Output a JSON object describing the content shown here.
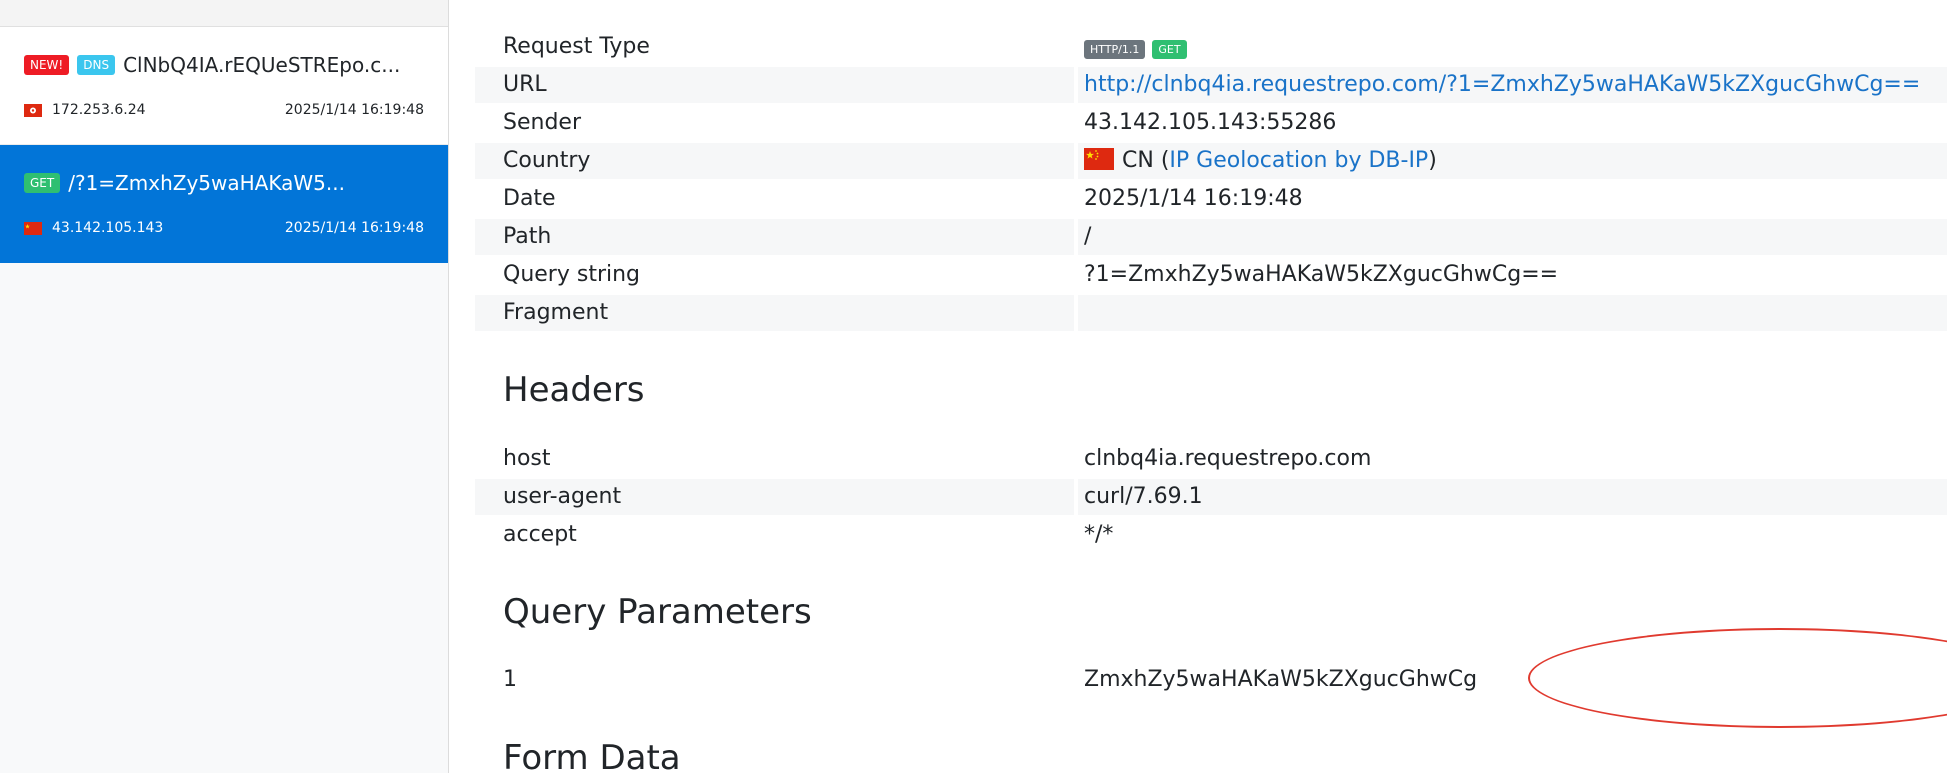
{
  "sidebar": {
    "requests": [
      {
        "badges": [
          "NEW!",
          "DNS"
        ],
        "title": "ClNbQ4IA.rEQUeSTREpo.c...",
        "ip": "172.253.6.24",
        "date": "2025/1/14 16:19:48",
        "selected": false,
        "flag_icon": "hong-kong-flag-icon"
      },
      {
        "badges": [
          "GET"
        ],
        "title": "/?1=ZmxhZy5waHAKaW5...",
        "ip": "43.142.105.143",
        "date": "2025/1/14 16:19:48",
        "selected": true,
        "flag_icon": "china-flag-icon"
      }
    ]
  },
  "details": {
    "request_type_label": "Request Type",
    "protocol_badge": "HTTP/1.1",
    "method_badge": "GET",
    "url_label": "URL",
    "url_value": "http://clnbq4ia.requestrepo.com/?1=ZmxhZy5waHAKaW5kZXgucGhwCg==",
    "sender_label": "Sender",
    "sender_value": "43.142.105.143:55286",
    "country_label": "Country",
    "country_code": "CN",
    "country_paren_open": "(",
    "country_link": "IP Geolocation by DB-IP",
    "country_paren_close": ")",
    "date_label": "Date",
    "date_value": "2025/1/14 16:19:48",
    "path_label": "Path",
    "path_value": "/",
    "query_label": "Query string",
    "query_value": "?1=ZmxhZy5waHAKaW5kZXgucGhwCg==",
    "fragment_label": "Fragment",
    "fragment_value": ""
  },
  "headers": {
    "heading": "Headers",
    "rows": [
      {
        "key": "host",
        "value": "clnbq4ia.requestrepo.com"
      },
      {
        "key": "user-agent",
        "value": "curl/7.69.1"
      },
      {
        "key": "accept",
        "value": "*/*"
      }
    ]
  },
  "query_parameters": {
    "heading": "Query Parameters",
    "rows": [
      {
        "key": "1",
        "value": "ZmxhZy5waHAKaW5kZXgucGhwCg"
      }
    ]
  },
  "form_data": {
    "heading": "Form Data"
  },
  "colors": {
    "selected_bg": "#0275d8",
    "link": "#1a73c8",
    "annotation": "#e03a2f"
  }
}
